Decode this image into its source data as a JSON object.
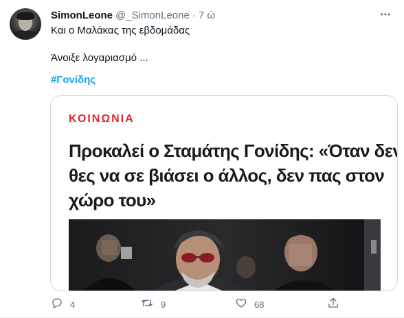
{
  "tweet": {
    "author_name": "SimonLeone",
    "author_handle": "@_SimonLeone",
    "separator": "·",
    "time": "7 ώ",
    "line1": "Και ο Μαλάκας της εβδομάδας",
    "line2": "Άνοιξε λογαριασμό ...",
    "hashtag": "#Γονίδης"
  },
  "card": {
    "category": "ΚΟΙΝΩΝΙΑ",
    "headline_lines": [
      "Προκαλεί ο Σταμάτης Γονίδης: «Όταν δεν",
      "θες να σε βιάσει ο άλλος, δεν πας στον",
      "χώρο του»"
    ]
  },
  "actions": {
    "reply_count": "4",
    "retweet_count": "9",
    "like_count": "68"
  },
  "icons": {
    "more": "more-icon",
    "reply": "reply-icon",
    "retweet": "retweet-icon",
    "like": "like-icon",
    "share": "share-icon"
  },
  "colors": {
    "link": "#1da1f2",
    "category": "#e3262b",
    "secondary_text": "#5b7083"
  }
}
